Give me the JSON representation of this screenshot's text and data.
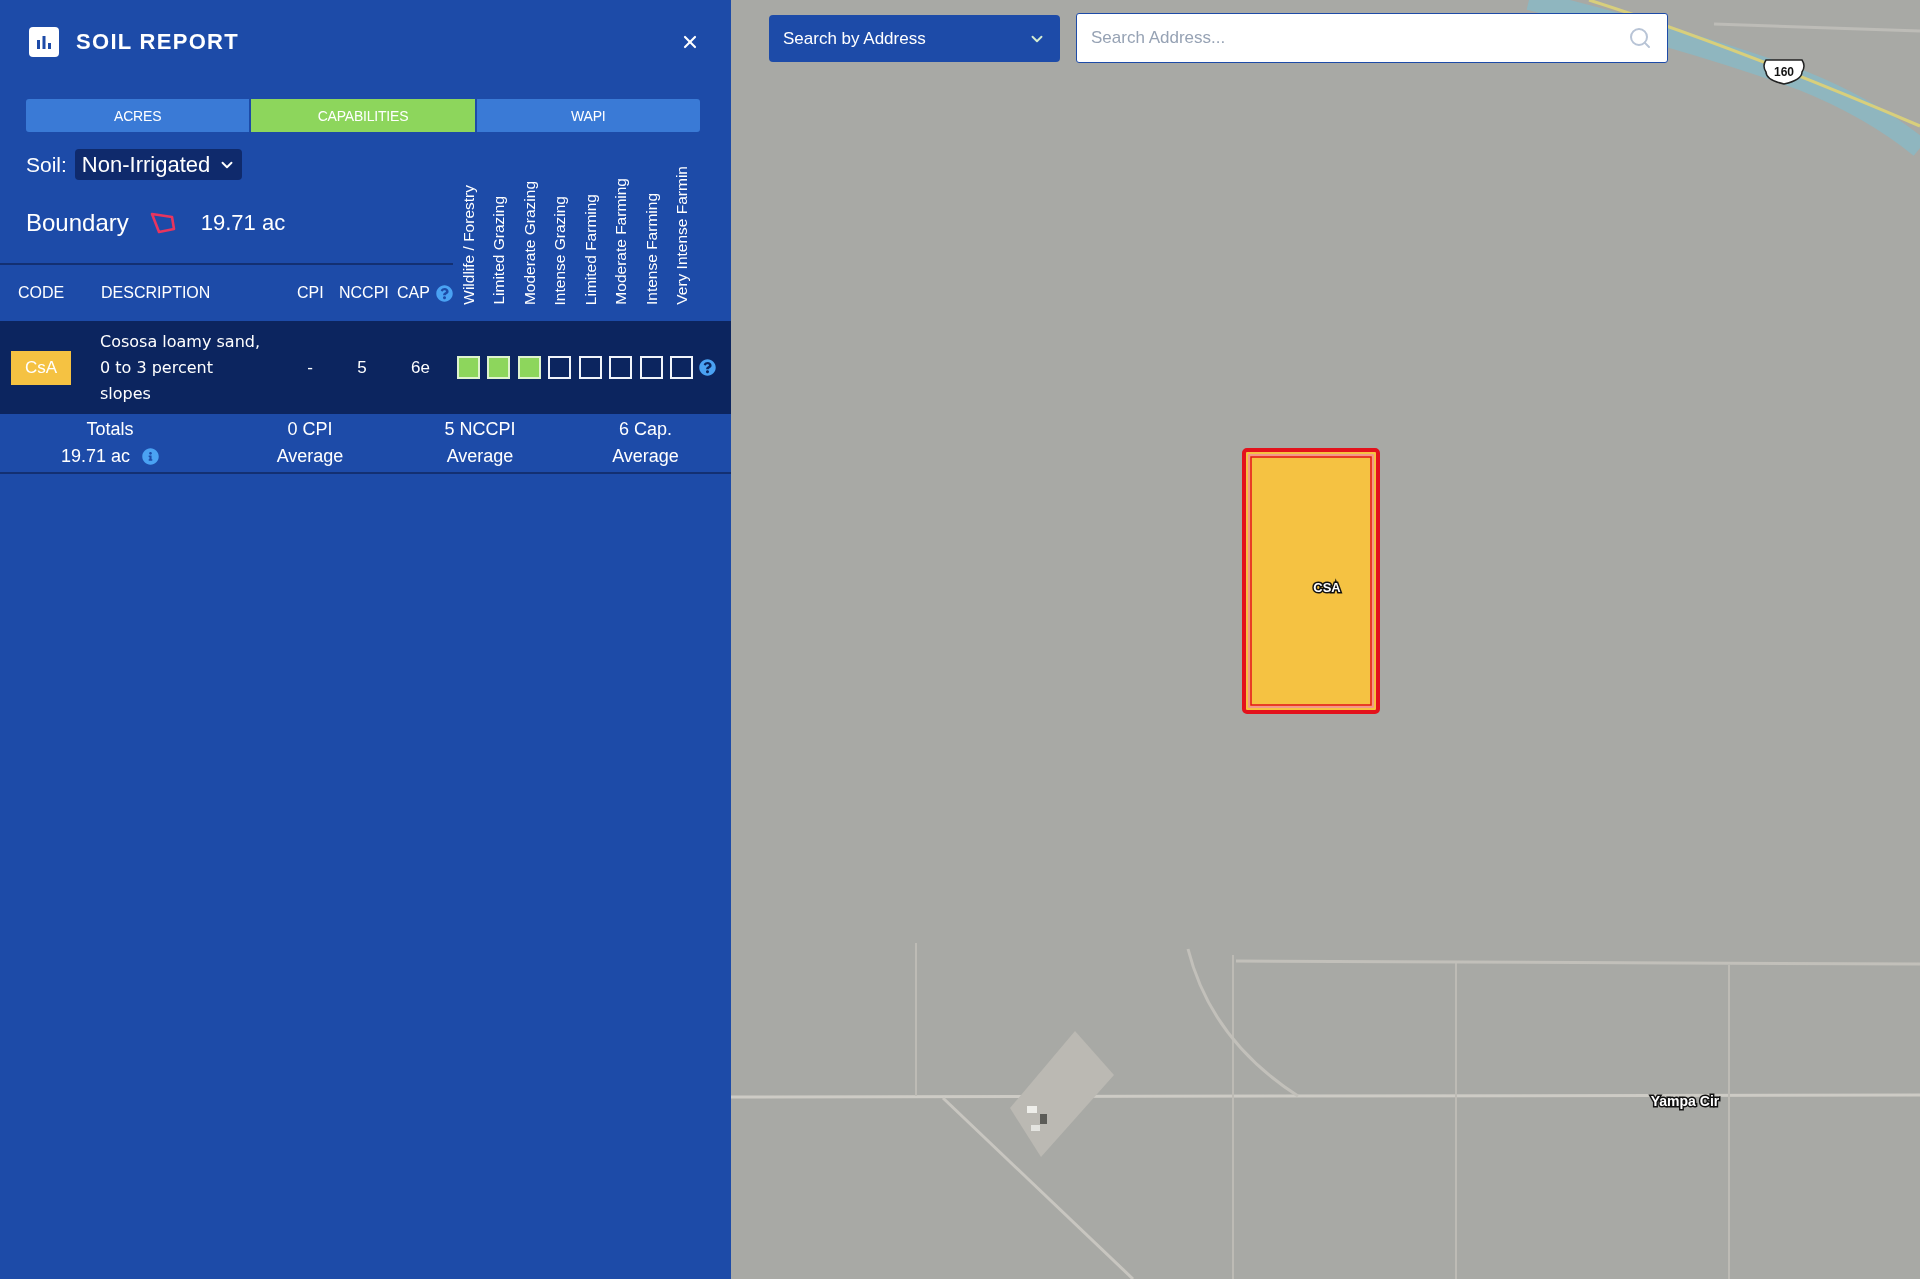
{
  "panel": {
    "title": "SOIL REPORT"
  },
  "tabs": [
    {
      "label": "ACRES",
      "selected": false
    },
    {
      "label": "CAPABILITIES",
      "selected": true
    },
    {
      "label": "WAPI",
      "selected": false
    }
  ],
  "soil": {
    "label": "Soil:",
    "value": "Non-Irrigated"
  },
  "boundary": {
    "label": "Boundary",
    "area": "19.71 ac"
  },
  "table": {
    "columns": [
      {
        "label": "CODE",
        "help": false
      },
      {
        "label": "DESCRIPTION",
        "help": false
      },
      {
        "label": "CPI",
        "help": false
      },
      {
        "label": "NCCPI",
        "help": false
      },
      {
        "label": "CAP",
        "help": true
      }
    ],
    "capability_classes": [
      "Wildlife / Forestry",
      "Limited Grazing",
      "Moderate Grazing",
      "Intense Grazing",
      "Limited Farming",
      "Moderate Farming",
      "Intense Farming",
      "Very Intense Farmin"
    ],
    "rows": [
      {
        "code": "CsA",
        "color": "#f5c242",
        "description": "Cososa loamy sand, 0 to 3 percent slopes",
        "cpi": "-",
        "nccpi": "5",
        "cap": "6e",
        "help": true,
        "capabilities": [
          {
            "filled": true
          },
          {
            "filled": true
          },
          {
            "filled": true
          },
          {
            "filled": false
          },
          {
            "filled": false
          },
          {
            "filled": false
          },
          {
            "filled": false
          },
          {
            "filled": false
          }
        ]
      }
    ]
  },
  "totals": [
    {
      "title": "Totals",
      "value": "19.71 ac",
      "info": true
    },
    {
      "title": "0 CPI",
      "value": "Average",
      "info": false
    },
    {
      "title": "5 NCCPI",
      "value": "Average",
      "info": false
    },
    {
      "title": "6 Cap.",
      "value": "Average",
      "info": false
    }
  ],
  "map": {
    "search_mode": "Search by Address",
    "search": {
      "placeholder": "Search Address..."
    },
    "route_shield": "160",
    "parcel_label": "CSA",
    "street_label": "Yampa Cir"
  }
}
